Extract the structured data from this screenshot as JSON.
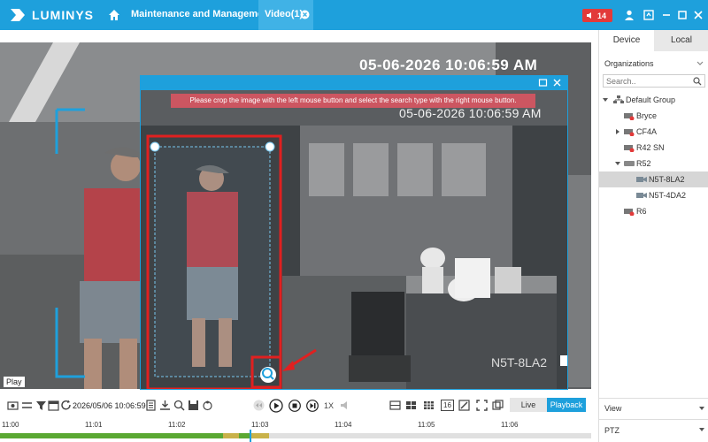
{
  "app": {
    "brand": "LUMINYS"
  },
  "tabs": [
    {
      "label": "Maintenance and Management"
    },
    {
      "label": "Video(1)"
    }
  ],
  "alarm": {
    "count": "14"
  },
  "video": {
    "timestamp": "05-06-2026 10:06:59 AM",
    "play_label": "Play"
  },
  "dialog": {
    "hint": "Please crop the image with the left mouse button and select the search type with the right mouse button.",
    "timestamp": "05-06-2026 10:06:59 AM",
    "camera_name": "N5T-8LA2"
  },
  "panel": {
    "tabs": [
      "Device",
      "Local"
    ],
    "org_title": "Organizations",
    "search_placeholder": "Search..",
    "tree": [
      {
        "label": "Default Group"
      },
      {
        "label": "Bryce"
      },
      {
        "label": "CF4A"
      },
      {
        "label": "R42 SN"
      },
      {
        "label": "R52"
      },
      {
        "label": "N5T-8LA2"
      },
      {
        "label": "N5T-4DA2"
      },
      {
        "label": "R6"
      }
    ],
    "view_label": "View",
    "ptz_label": "PTZ"
  },
  "toolbar": {
    "datetime": "2026/05/06 10:06:59",
    "speed": "1X",
    "live": "Live",
    "playback": "Playback",
    "layout_count": "16"
  },
  "timeline": {
    "ticks": [
      "11:00",
      "11:01",
      "11:02",
      "11:03",
      "11:04",
      "11:05",
      "11:06"
    ]
  },
  "colors": {
    "accent": "#1ea0dc",
    "alarm": "#e23a3a",
    "crop_box": "#e02020",
    "banner": "#d65662",
    "recording_green": "#5aa832",
    "recording_yellow": "#c9b24a"
  }
}
